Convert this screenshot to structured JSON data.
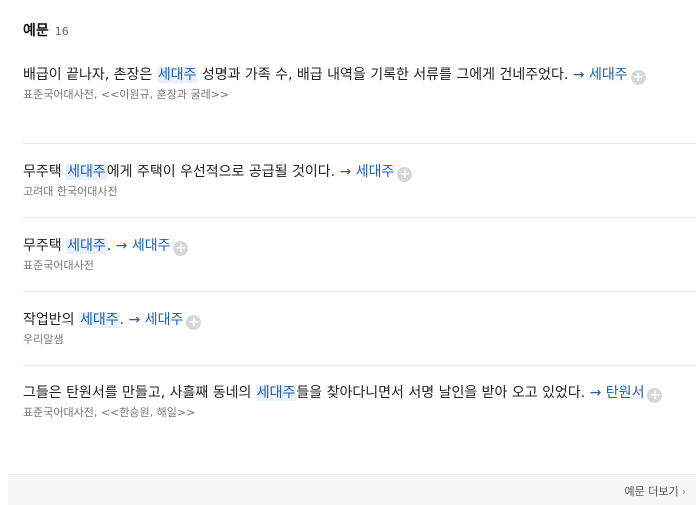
{
  "section": {
    "title": "예문",
    "count": "16"
  },
  "examples": [
    {
      "pre": "배급이 끝나자, 촌장은 ",
      "highlight": "세대주",
      "post": " 성명과 가족 수, 배급 내역을 기록한 서류를 그에게 건네주었다. ",
      "link": "→ 세대주",
      "source": "표준국어대사전, <<이원규, 훈장과 굴레>>"
    },
    {
      "pre": "무주택 ",
      "highlight": "세대주",
      "post": "에게 주택이 우선적으로 공급될 것이다. ",
      "link": "→ 세대주",
      "source": "고려대 한국어대사전"
    },
    {
      "pre": "무주택 ",
      "highlight": "세대주",
      "post": ". ",
      "link": "→ 세대주",
      "source": "표준국어대사전"
    },
    {
      "pre": "작업반의 ",
      "highlight": "세대주",
      "post": ". ",
      "link": "→ 세대주",
      "source": "우리말샘"
    },
    {
      "pre": "그들은 탄원서를 만들고, 사흘째 동네의 ",
      "highlight": "세대주",
      "post": "들을 찾아다니면서 서명 날인을 받아 오고 있었다. ",
      "link": "→ 탄원서",
      "source": "표준국어대사전, <<한승원, 해일>>"
    }
  ],
  "plus_symbol": "+",
  "footer": {
    "more_label": "예문 더보기",
    "chevron": "›"
  },
  "colors": {
    "link": "#1c5fb4",
    "highlight_bg": "#e8f1fb"
  }
}
